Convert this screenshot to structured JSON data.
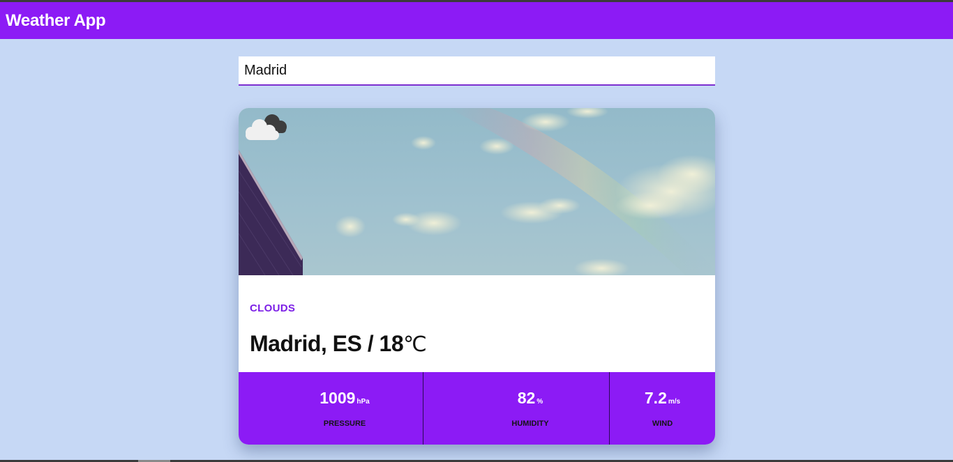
{
  "app": {
    "title": "Weather App"
  },
  "search": {
    "value": "Madrid"
  },
  "weather": {
    "description": "CLOUDS",
    "location": "Madrid, ES / 18",
    "temp_unit": "℃",
    "icon": "cloudy-icon"
  },
  "stats": [
    {
      "value": "1009",
      "unit": "hPa",
      "label": "PRESSURE"
    },
    {
      "value": "82",
      "unit": "%",
      "label": "HUMIDITY"
    },
    {
      "value": "7.2",
      "unit": "m/s",
      "label": "WIND"
    }
  ],
  "colors": {
    "accent": "#8c1bf5",
    "background": "#c6d8f5",
    "description_text": "#7c1fe6"
  }
}
